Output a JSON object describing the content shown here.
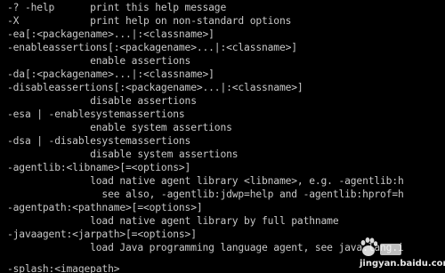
{
  "console": {
    "lines": [
      "-? -help      print this help message",
      "-X            print help on non-standard options",
      "-ea[:<packagename>...|:<classname>]",
      "-enableassertions[:<packagename>...|:<classname>]",
      "              enable assertions",
      "-da[:<packagename>...|:<classname>]",
      "-disableassertions[:<packagename>...|:<classname>]",
      "              disable assertions",
      "-esa | -enablesystemassertions",
      "              enable system assertions",
      "-dsa | -disablesystemassertions",
      "              disable system assertions",
      "-agentlib:<libname>[=<options>]",
      "              load native agent library <libname>, e.g. -agentlib:h",
      "                see also, -agentlib:jdwp=help and -agentlib:hprof=h",
      "-agentpath:<pathname>[=<options>]",
      "              load native agent library by full pathname",
      "-javaagent:<jarpath>[=<options>]",
      "              load Java programming language agent, see java.lang.i",
      "",
      "-splash:<imagepath>"
    ],
    "text_color": "#c8c8c8",
    "background_color": "#000000"
  },
  "watermark": {
    "text": "jingyan.baidu.com",
    "logo": "baidu-paw-logo"
  }
}
